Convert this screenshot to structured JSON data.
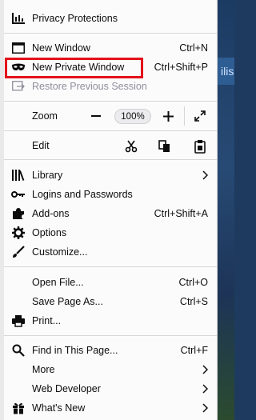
{
  "menu": {
    "privacy_protections": "Privacy Protections",
    "new_window": "New Window",
    "new_window_shortcut": "Ctrl+N",
    "new_private_window": "New Private Window",
    "new_private_window_shortcut": "Ctrl+Shift+P",
    "restore_previous_session": "Restore Previous Session",
    "zoom_label": "Zoom",
    "zoom_level": "100%",
    "edit_label": "Edit",
    "library": "Library",
    "logins_and_passwords": "Logins and Passwords",
    "addons": "Add-ons",
    "addons_shortcut": "Ctrl+Shift+A",
    "options": "Options",
    "customize": "Customize...",
    "open_file": "Open File...",
    "open_file_shortcut": "Ctrl+O",
    "save_page_as": "Save Page As...",
    "save_page_as_shortcut": "Ctrl+S",
    "print": "Print...",
    "find_in_page": "Find in This Page...",
    "find_in_page_shortcut": "Ctrl+F",
    "more": "More",
    "web_developer": "Web Developer",
    "whats_new": "What's New"
  },
  "colors": {
    "highlight_border": "#e3121a",
    "menu_background": "#fbfbfb"
  },
  "background_window": {
    "fragment": "ilis"
  }
}
